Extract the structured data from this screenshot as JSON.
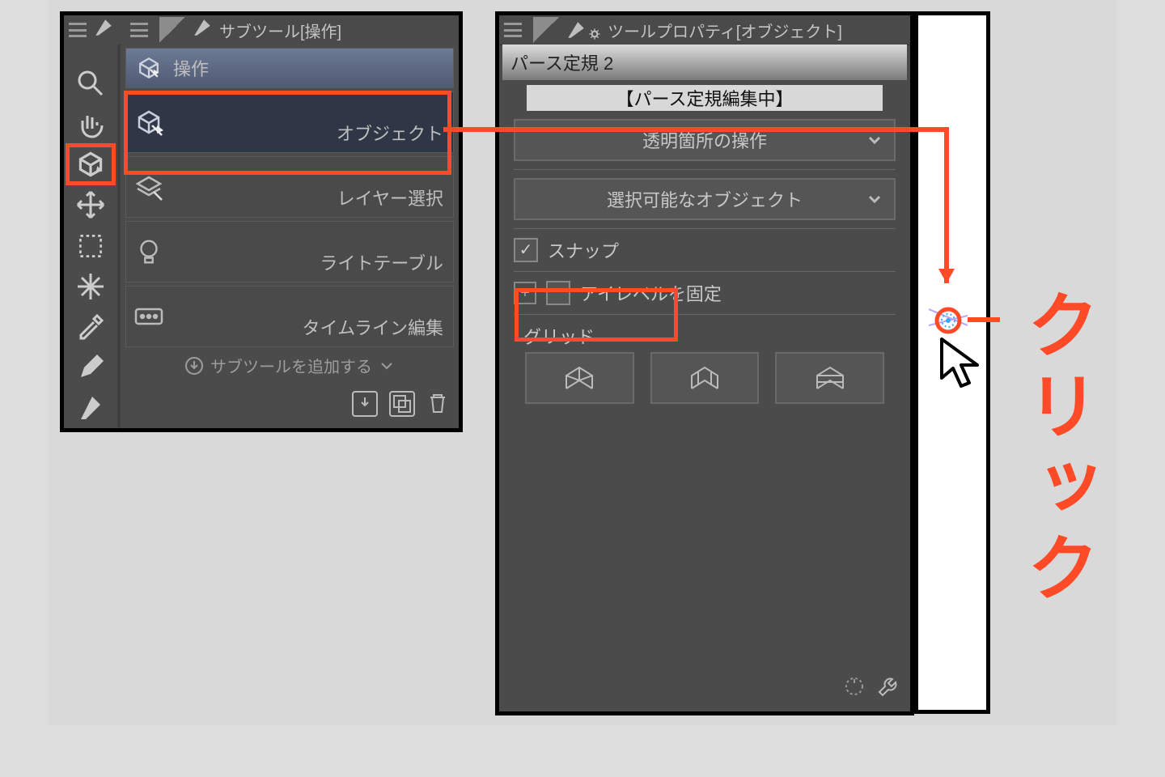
{
  "subtool": {
    "title": "サブツール[操作]",
    "group_label": "操作",
    "items": [
      "オブジェクト",
      "レイヤー選択",
      "ライトテーブル",
      "タイムライン編集"
    ],
    "add_label": "サブツールを追加する"
  },
  "toolstrip": {
    "icons": [
      "menu-icon",
      "pen-tip-icon",
      "magnifier-icon",
      "hand-icon",
      "object-cube-icon",
      "move-icon",
      "marquee-icon",
      "sparkle-icon",
      "eyedropper-icon",
      "pencil-icon",
      "pen-icon"
    ]
  },
  "property": {
    "title": "ツールプロパティ[オブジェクト]",
    "layer_name": "パース定規 2",
    "layer_status": "【パース定規編集中】",
    "dd1": "透明箇所の操作",
    "dd2": "選択可能なオブジェクト",
    "snap_label": "スナップ",
    "snap_checked": true,
    "eyelevel_label": "アイレベルを固定",
    "eyelevel_checked": false,
    "grid_label": "グリッド",
    "grid_modes": [
      "xy",
      "yz",
      "xz"
    ]
  },
  "annotation": {
    "click_text": "クリック",
    "color": "#ff4a28"
  }
}
